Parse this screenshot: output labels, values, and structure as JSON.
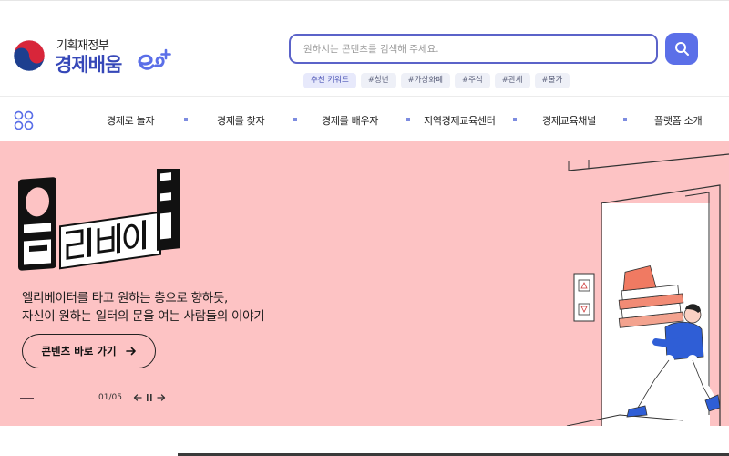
{
  "header": {
    "gov_name": "기획재정부",
    "brand_name": "경제배움",
    "search": {
      "placeholder": "원하시는 콘텐츠를 검색해 주세요.",
      "value": ""
    },
    "keywords_label": "추천 키워드",
    "keywords": [
      "#청년",
      "#가상화폐",
      "#주식",
      "#관세",
      "#물가"
    ]
  },
  "nav": {
    "items": [
      "경제로 놀자",
      "경제를 찾자",
      "경제를 배우자",
      "지역경제교육센터",
      "경제교육채널",
      "플랫폼 소개"
    ]
  },
  "banner": {
    "art_text": "엘리베이터",
    "line1": "엘리베이터를 타고 원하는 층으로 향하듯,",
    "line2": "자신이 원하는 일터의 문을 여는 사람들의 이야기",
    "cta_label": "콘텐츠 바로 가기",
    "counter": "01/05",
    "progress": 0.2
  },
  "colors": {
    "brand": "#3547b8",
    "accent": "#5b6fe8",
    "banner_bg": "#fdc3c4",
    "person": "#2f5ed6"
  }
}
